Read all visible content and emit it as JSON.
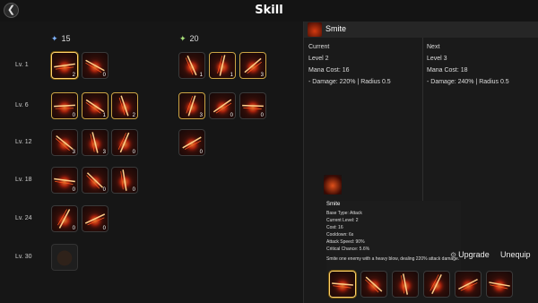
{
  "header": {
    "title": "Skill",
    "back_icon": "back-arrow-icon"
  },
  "points": [
    {
      "value": "15",
      "icon": "blue-star-icon"
    },
    {
      "value": "20",
      "icon": "green-star-icon"
    }
  ],
  "levels": [
    "Lv. 1",
    "Lv. 6",
    "Lv. 12",
    "Lv. 18",
    "Lv. 24",
    "Lv. 30"
  ],
  "skill_rows": [
    {
      "left": [
        {
          "count": "2",
          "state": "sel"
        },
        {
          "count": "0",
          "state": "normal"
        }
      ],
      "right": [
        {
          "count": "1",
          "state": "normal"
        },
        {
          "count": "1",
          "state": "eq"
        },
        {
          "count": "3",
          "state": "eq"
        }
      ]
    },
    {
      "left": [
        {
          "count": "0",
          "state": "eq"
        },
        {
          "count": "1",
          "state": "eq"
        },
        {
          "count": "2",
          "state": "eq"
        }
      ],
      "right": [
        {
          "count": "3",
          "state": "eq"
        },
        {
          "count": "0",
          "state": "normal"
        },
        {
          "count": "0",
          "state": "normal"
        }
      ]
    },
    {
      "left": [
        {
          "count": "3",
          "state": "normal"
        },
        {
          "count": "3",
          "state": "normal"
        },
        {
          "count": "0",
          "state": "normal"
        }
      ],
      "right": [
        {
          "count": "0",
          "state": "normal"
        }
      ]
    },
    {
      "left": [
        {
          "count": "0",
          "state": "normal"
        },
        {
          "count": "0",
          "state": "normal"
        },
        {
          "count": "0",
          "state": "normal"
        }
      ],
      "right": []
    },
    {
      "left": [
        {
          "count": "0",
          "state": "normal"
        },
        {
          "count": "0",
          "state": "normal"
        }
      ],
      "right": []
    },
    {
      "left": [
        {
          "count": "",
          "state": "locked"
        }
      ],
      "right": []
    }
  ],
  "detail": {
    "name": "Smite",
    "current": {
      "heading": "Current",
      "level": "Level 2",
      "mana": "Mana Cost: 16",
      "damage": "- Damage: 220% | Radius 0.5"
    },
    "next": {
      "heading": "Next",
      "level": "Level 3",
      "mana": "Mana Cost: 18",
      "damage": "- Damage: 240% | Radius 0.5"
    }
  },
  "tooltip": {
    "name": "Smite",
    "stats": [
      "Base Type: Attack",
      "Current Level: 2",
      "Cost: 16",
      "Cooldown: 6s",
      "Attack Speed: 90%",
      "Critical Chance: 5.6%"
    ],
    "description": "Smite one enemy with a heavy blow, dealing 220% attack damage."
  },
  "actions": {
    "upgrade": "Upgrade",
    "unequip": "Unequip"
  },
  "equipped_count": 6
}
